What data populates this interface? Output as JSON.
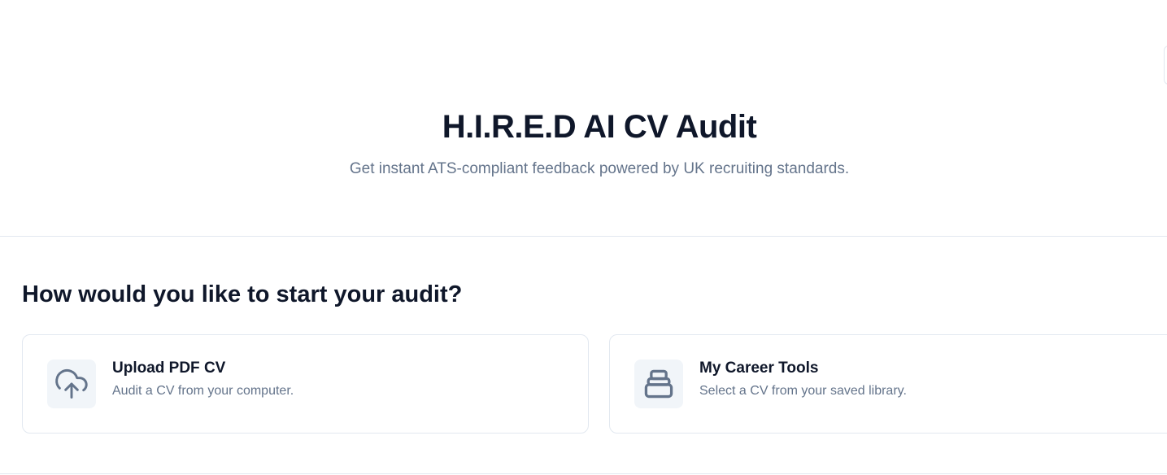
{
  "header": {
    "title": "H.I.R.E.D AI CV Audit",
    "subtitle": "Get instant ATS-compliant feedback powered by UK recruiting standards."
  },
  "start": {
    "heading": "How would you like to start your audit?",
    "options": [
      {
        "title": "Upload PDF CV",
        "description": "Audit a CV from your computer.",
        "icon": "cloud-upload-icon"
      },
      {
        "title": "My Career Tools",
        "description": "Select a CV from your saved library.",
        "icon": "archive-icon"
      }
    ]
  },
  "colors": {
    "text_primary": "#0f172a",
    "text_muted": "#64748b",
    "border": "#e2e8f0",
    "icon_bg": "#f1f5f9",
    "icon_stroke": "#64748b"
  }
}
